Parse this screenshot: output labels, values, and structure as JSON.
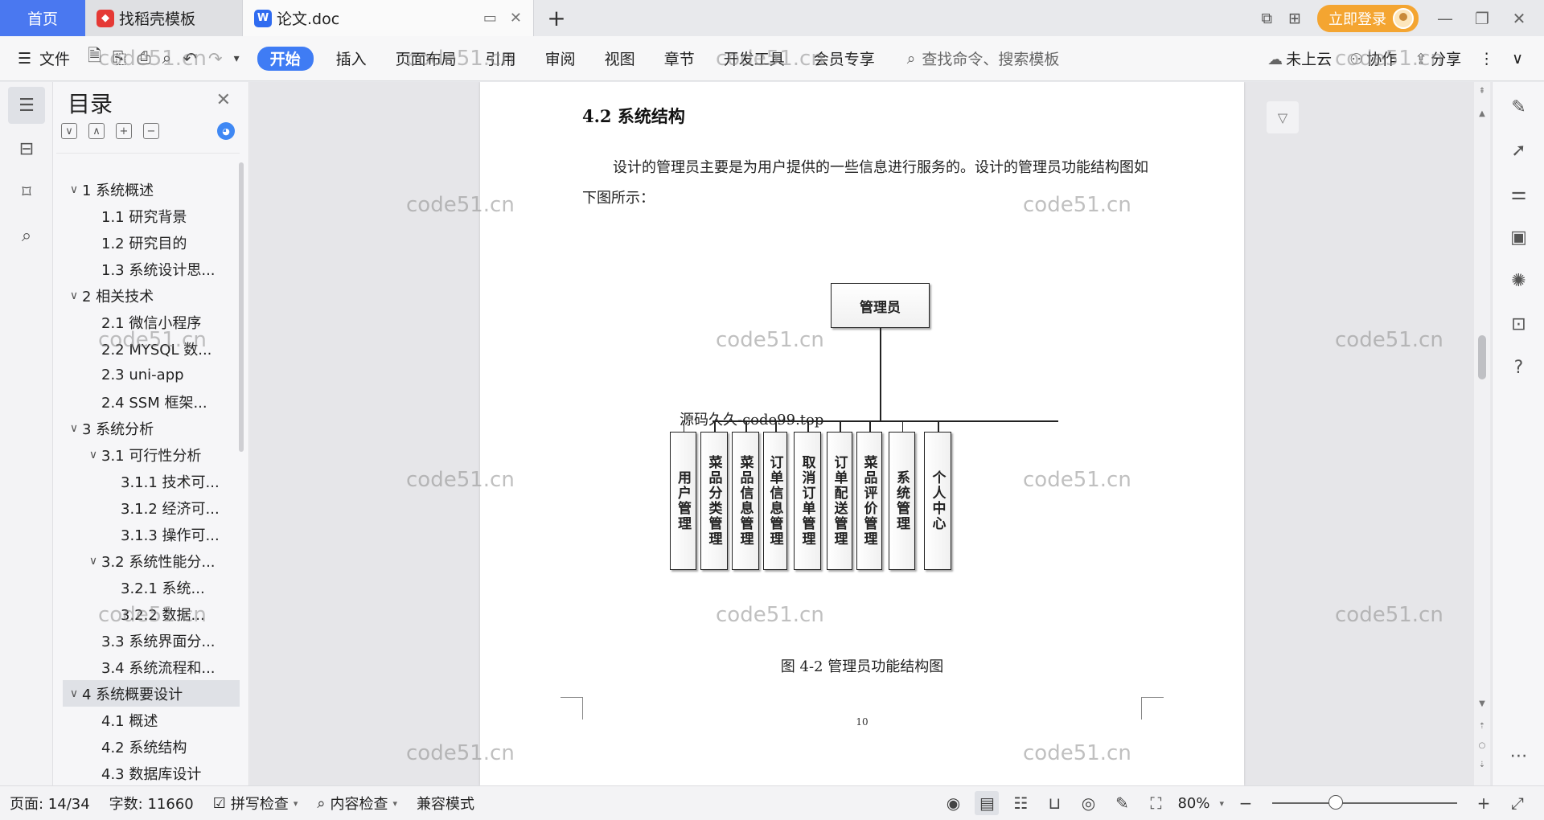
{
  "titlebar": {
    "home_tab": "首页",
    "tabs": [
      {
        "label": "找稻壳模板",
        "icon": "docer-icon",
        "color": "#e53935"
      },
      {
        "label": "论文.doc",
        "icon": "wps-writer-icon",
        "color": "#2f6bf0"
      }
    ],
    "login_label": "立即登录"
  },
  "ribbon": {
    "file_label": "文件",
    "tabs": [
      "开始",
      "插入",
      "页面布局",
      "引用",
      "审阅",
      "视图",
      "章节",
      "开发工具",
      "会员专享"
    ],
    "active_tab": "开始",
    "search_placeholder": "查找命令、搜索模板",
    "cloud_label": "未上云",
    "collab_label": "协作",
    "share_label": "分享"
  },
  "toc": {
    "title": "目录",
    "items": [
      {
        "label": "1 系统概述",
        "level": "lvl1",
        "caret": "∨"
      },
      {
        "label": "1.1  研究背景",
        "level": "lvl2",
        "caret": ""
      },
      {
        "label": "1.2 研究目的",
        "level": "lvl2",
        "caret": ""
      },
      {
        "label": "1.3 系统设计思...",
        "level": "lvl2",
        "caret": ""
      },
      {
        "label": "2 相关技术",
        "level": "lvl1",
        "caret": "∨"
      },
      {
        "label": "2.1 微信小程序",
        "level": "lvl2",
        "caret": ""
      },
      {
        "label": "2.2 MYSQL 数...",
        "level": "lvl2",
        "caret": ""
      },
      {
        "label": "2.3 uni-app",
        "level": "lvl2",
        "caret": ""
      },
      {
        "label": "2.4 SSM 框架...",
        "level": "lvl2",
        "caret": ""
      },
      {
        "label": "3 系统分析",
        "level": "lvl1",
        "caret": "∨"
      },
      {
        "label": "3.1 可行性分析",
        "level": "lvl2c",
        "caret": "∨"
      },
      {
        "label": "3.1.1 技术可...",
        "level": "lvl3",
        "caret": ""
      },
      {
        "label": "3.1.2 经济可...",
        "level": "lvl3",
        "caret": ""
      },
      {
        "label": "3.1.3 操作可...",
        "level": "lvl3",
        "caret": ""
      },
      {
        "label": "3.2 系统性能分...",
        "level": "lvl2c",
        "caret": "∨"
      },
      {
        "label": "3.2.1  系统...",
        "level": "lvl3",
        "caret": ""
      },
      {
        "label": "3.2.2  数据...",
        "level": "lvl3",
        "caret": ""
      },
      {
        "label": "3.3 系统界面分...",
        "level": "lvl2",
        "caret": ""
      },
      {
        "label": "3.4 系统流程和...",
        "level": "lvl2",
        "caret": ""
      },
      {
        "label": "4 系统概要设计",
        "level": "lvl1",
        "caret": "∨",
        "selected": true
      },
      {
        "label": "4.1 概述",
        "level": "lvl2",
        "caret": ""
      },
      {
        "label": "4.2 系统结构",
        "level": "lvl2",
        "caret": ""
      },
      {
        "label": "4.3 数据库设计",
        "level": "lvl2",
        "caret": ""
      }
    ]
  },
  "document": {
    "section_title": "4.2 系统结构",
    "paragraph": "设计的管理员主要是为用户提供的一些信息进行服务的。设计的管理员功能结构图如下图所示：",
    "diagram_root": "管理员",
    "diagram_children": [
      "用户管理",
      "菜品分类管理",
      "菜品信息管理",
      "订单信息管理",
      "取消订单管理",
      "订单配送管理",
      "菜品评价管理",
      "系统管理",
      "个人中心"
    ],
    "inline_watermark": "源码久久-code99.top",
    "caption": "图 4-2 管理员功能结构图",
    "page_number": "10",
    "watermark": "code51.cn"
  },
  "statusbar": {
    "page": "页面: 14/34",
    "words": "字数: 11660",
    "spell": "拼写检查",
    "content": "内容检查",
    "compat": "兼容模式",
    "zoom": "80%"
  }
}
